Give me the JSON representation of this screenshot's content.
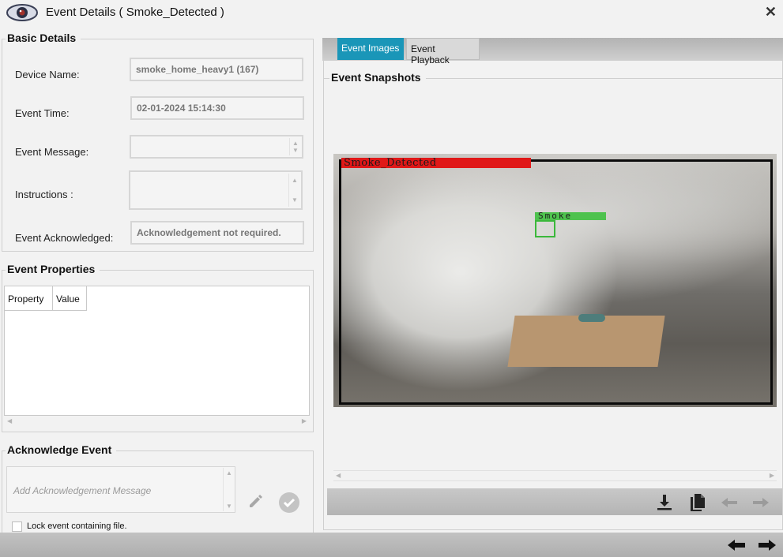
{
  "window": {
    "title": "Event Details ( Smoke_Detected )",
    "close_symbol": "✕"
  },
  "basic_details": {
    "title": "Basic Details",
    "device_name_label": "Device Name:",
    "device_name_value": "smoke_home_heavy1 (167)",
    "event_time_label": "Event Time:",
    "event_time_value": "02-01-2024 15:14:30",
    "event_message_label": "Event Message:",
    "event_message_value": "",
    "instructions_label": "Instructions :",
    "instructions_value": "",
    "ack_label": "Event Acknowledged:",
    "ack_value": "Acknowledgement not required."
  },
  "event_properties": {
    "title": "Event Properties",
    "columns": [
      "Property",
      "Value"
    ],
    "rows": []
  },
  "acknowledge_event": {
    "title": "Acknowledge Event",
    "placeholder": "Add Acknowledgement Message",
    "lock_checkbox_label": "Lock event containing file.",
    "lock_checked": false
  },
  "tabs": [
    {
      "label": "Event Images",
      "active": true
    },
    {
      "label": "Event Playback",
      "active": false
    }
  ],
  "snapshots": {
    "title": "Event Snapshots",
    "overlay_label": "Smoke_Detected",
    "detection_label": "Smoke"
  },
  "icons": {
    "app": "eye-icon",
    "download": "download-icon",
    "copy": "copy-icon",
    "prev": "arrow-left-icon",
    "next": "arrow-right-icon",
    "edit": "pencil-icon",
    "confirm": "check-circle-icon"
  },
  "colors": {
    "active_tab": "#1a96b8",
    "overlay_red": "#e01818",
    "detection_green": "#3bb83b"
  }
}
